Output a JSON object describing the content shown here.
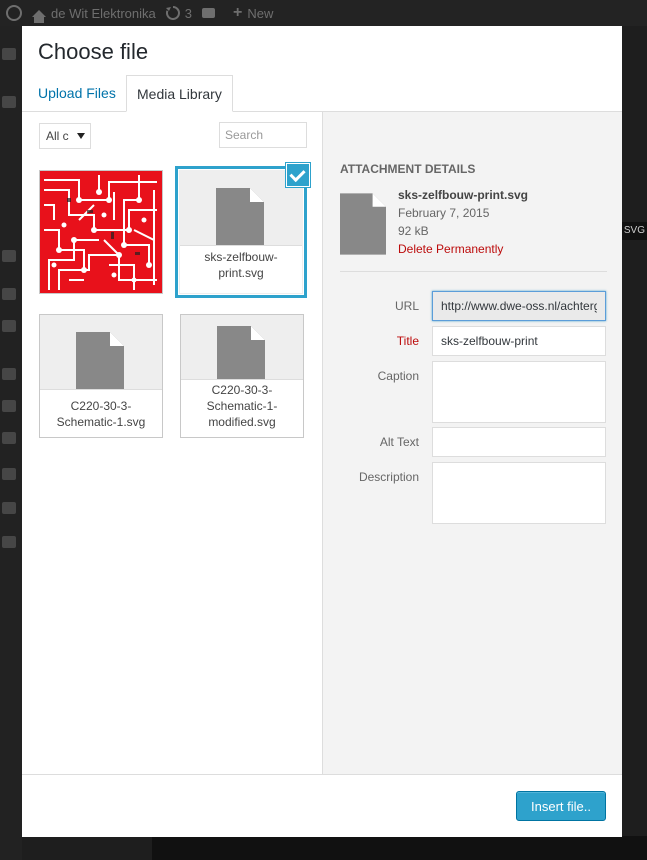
{
  "adminbar": {
    "site_name": "de Wit Elektronika",
    "updates_count": "3",
    "new_label": "New"
  },
  "side_strip": {
    "label": "SVG"
  },
  "modal": {
    "title": "Choose file",
    "tabs": [
      {
        "label": "Upload Files",
        "active": false
      },
      {
        "label": "Media Library",
        "active": true
      }
    ],
    "filter": {
      "selected": "All c"
    },
    "search": {
      "placeholder": "Search",
      "value": ""
    },
    "attachments": [
      {
        "kind": "image",
        "filename": "",
        "selected": false
      },
      {
        "kind": "file",
        "filename": "sks-zelfbouw-print.svg",
        "name_lines": [
          "sks-zelfbouw-",
          "print.svg"
        ],
        "selected": true
      },
      {
        "kind": "file",
        "filename": "C220-30-3-Schematic-1.svg",
        "name_lines": [
          "C220-30-3-",
          "Schematic-1.svg"
        ],
        "selected": false
      },
      {
        "kind": "file",
        "filename": "C220-30-3-Schematic-1-modified.svg",
        "name_lines": [
          "C220-30-3-",
          "Schematic-1-",
          "modified.svg"
        ],
        "selected": false
      }
    ],
    "details": {
      "heading": "Attachment Details",
      "filename": "sks-zelfbouw-print.svg",
      "date": "February 7, 2015",
      "size": "92 kB",
      "delete_label": "Delete Permanently",
      "fields": {
        "url_label": "URL",
        "url_value": "http://www.dwe-oss.nl/achtergrond/sks-zelfbouw-print.svg",
        "title_label": "Title",
        "title_value": "sks-zelfbouw-print",
        "caption_label": "Caption",
        "caption_value": "",
        "alt_label": "Alt Text",
        "alt_value": "",
        "description_label": "Description",
        "description_value": ""
      }
    },
    "insert_label": "Insert file.."
  },
  "colors": {
    "accent": "#2ea2cc",
    "link": "#0073aa",
    "danger": "#bc0b0b",
    "pcb_red": "#e8111b",
    "file_icon": "#888888"
  }
}
